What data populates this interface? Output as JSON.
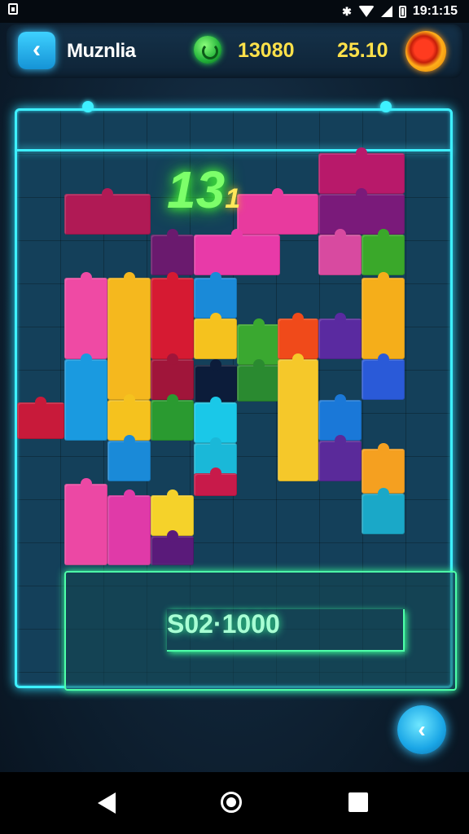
{
  "status_bar": {
    "time": "19:1:15"
  },
  "header": {
    "title": "Muznlia",
    "score": "13080",
    "timer": "25.10"
  },
  "board": {
    "glow_number": "13",
    "glow_suffix": "1",
    "target_text": "S02·1000"
  },
  "colors": {
    "accent": "#3ef0ff",
    "score": "#ffe14a",
    "target": "#4dffa8"
  },
  "icons": {
    "back": "back-arrow-icon",
    "gem": "green-gem-icon",
    "orb": "fire-orb-icon",
    "fab": "back-arrow-icon"
  }
}
